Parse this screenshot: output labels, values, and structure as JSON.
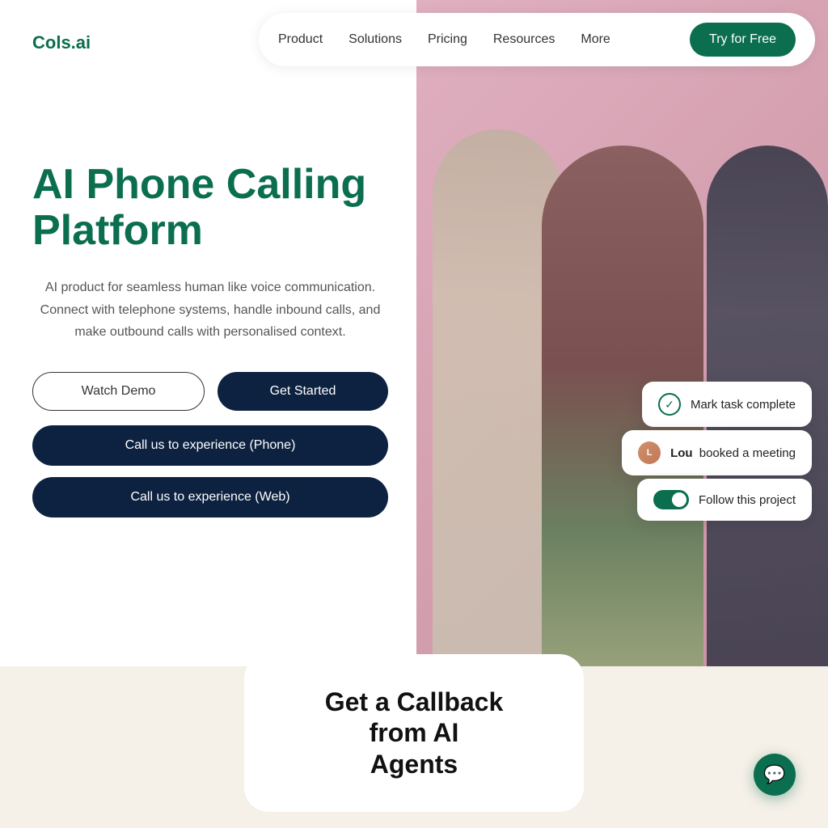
{
  "brand": {
    "logo": "Cols.ai",
    "color": "#0a6e4f"
  },
  "nav": {
    "links": [
      "Product",
      "Solutions",
      "Pricing",
      "Resources",
      "More"
    ],
    "cta_label": "Try for Free"
  },
  "hero": {
    "title_line1": "AI Phone Calling",
    "title_line2": "Platform",
    "description": "AI product for seamless human like voice communication. Connect with telephone systems, handle inbound calls, and make outbound calls with personalised context.",
    "btn_watch_demo": "Watch Demo",
    "btn_get_started": "Get Started",
    "btn_call_phone": "Call us to experience (Phone)",
    "btn_call_web": "Call us to experience (Web)"
  },
  "floating_cards": {
    "card1_label": "Mark task complete",
    "card2_name": "Lou",
    "card2_label": "booked a meeting",
    "card3_label": "Follow this project"
  },
  "bottom": {
    "title_line1": "Get a Callback from AI",
    "title_line2": "Agents"
  },
  "chat_icon": "💬"
}
